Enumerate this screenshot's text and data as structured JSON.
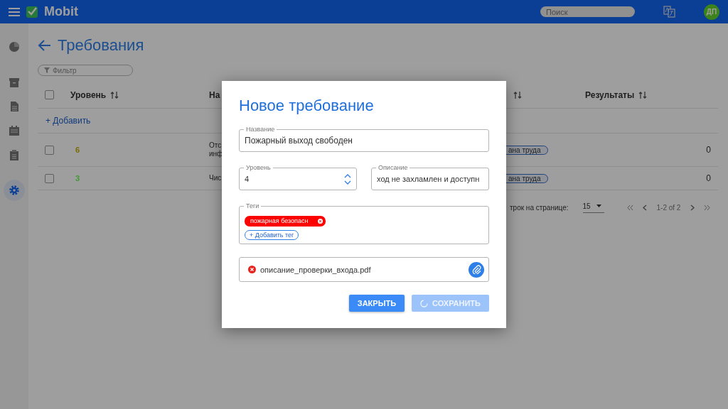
{
  "header": {
    "logo": "Mobit",
    "search": {
      "placeholder": "Поиск"
    },
    "avatar": "ДП"
  },
  "sidebar": {
    "items": [
      {
        "kind": "chart",
        "selected": false
      },
      {
        "kind": "archive",
        "selected": false
      },
      {
        "kind": "document",
        "selected": false
      },
      {
        "kind": "calendar",
        "selected": false
      },
      {
        "kind": "clipboard",
        "selected": false
      },
      {
        "kind": "settings",
        "selected": true
      }
    ]
  },
  "page": {
    "title": "Требования",
    "filter": {
      "placeholder": "Фильтр"
    }
  },
  "table": {
    "columns": [
      {
        "label": "Уровень",
        "sortable": true
      },
      {
        "label": "На",
        "sortable": false
      },
      {
        "sortable": true
      },
      {
        "label": "Результаты",
        "sortable": true
      }
    ],
    "select_all": {
      "checked": false
    },
    "add_link": "+ Добавить",
    "rows": [
      {
        "selected": false,
        "level": "6",
        "color": "#7a6c00",
        "name": [
          "Отс",
          "инф"
        ],
        "tag": "ана труда",
        "results": "0"
      },
      {
        "selected": false,
        "level": "3",
        "color": "#3f9a2f",
        "name": [
          "Чис"
        ],
        "tag": "ана труда",
        "results": "0"
      }
    ],
    "pagination": {
      "rows_label": "трок на странице:",
      "per_page": "15",
      "range": "1-2 of 2"
    }
  },
  "dialog": {
    "title": "Новое требование",
    "name_field": {
      "label": "Название",
      "value": "Пожарный выход свободен"
    },
    "level_field": {
      "label": "Уровень",
      "value": "4"
    },
    "description_field": {
      "label": "Описание",
      "value": "ход не захламлен и доступн"
    },
    "tags_field": {
      "label": "Теги",
      "tags": [
        "пожарная безопасн"
      ],
      "add_button": "+ Добавить тег"
    },
    "attachment": "описание_проверки_входа.pdf",
    "buttons": [
      {
        "label": "ЗАКРЫТЬ",
        "disabled": false,
        "loading": false
      },
      {
        "label": "СОХРАНИТЬ",
        "disabled": true,
        "loading": true
      }
    ]
  }
}
